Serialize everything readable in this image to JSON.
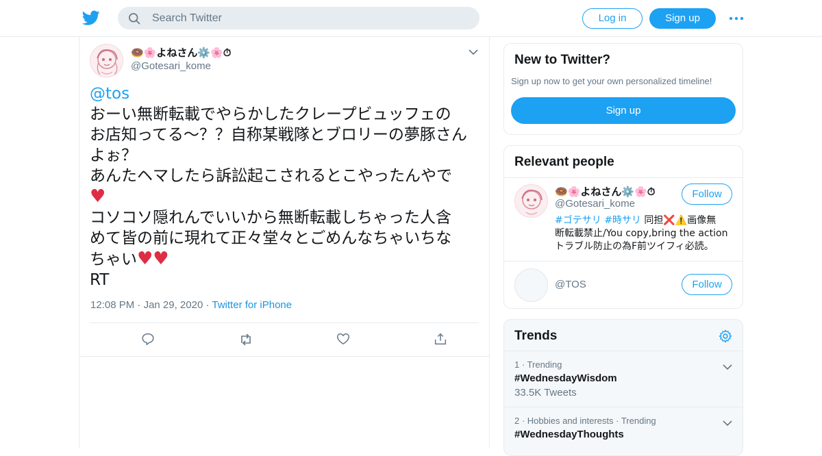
{
  "header": {
    "search_placeholder": "Search Twitter",
    "login_label": "Log in",
    "signup_label": "Sign up",
    "brand_color": "#1da1f2"
  },
  "tweet": {
    "name": "🍩🌸よねさん⚙️🌸⏱",
    "handle": "@Gotesari_kome",
    "mention": "@tos",
    "lines": [
      "おーい無断転載でやらかしたクレープビュッフェの",
      "お店知ってる〜？？自称某戦隊とブロリーの夢豚さん",
      "よぉ？",
      "あんたヘマしたら訴訟起こされるとこやったんやで",
      "コソコソ隠れんでいいから無断転載しちゃった人含",
      "めて皆の前に現れて正々堂々とごめんなちゃいちな",
      "ちゃい",
      "RT"
    ],
    "time": "12:08 PM",
    "date": "Jan 29, 2020",
    "source": "Twitter for iPhone"
  },
  "new_to_twitter": {
    "title": "New to Twitter?",
    "subtitle": "Sign up now to get your own personalized timeline!",
    "button": "Sign up"
  },
  "relevant_people": {
    "title": "Relevant people",
    "people": [
      {
        "name": "🍩🌸よねさん⚙️🌸⏱",
        "handle": "@Gotesari_kome",
        "bio_tag1": "#ゴテサリ",
        "bio_tag2": "#時サリ",
        "bio_rest1": " 同担❌⚠️画像無",
        "bio_rest2": "断転載禁止/You copy,bring the action",
        "bio_rest3": "トラブル防止の為F前ツイフィ必読。",
        "follow": "Follow"
      },
      {
        "name": "",
        "handle": "@TOS",
        "follow": "Follow"
      }
    ]
  },
  "trends": {
    "title": "Trends",
    "items": [
      {
        "meta": "1 · Trending",
        "name": "#WednesdayWisdom",
        "count": "33.5K Tweets"
      },
      {
        "meta": "2 · Hobbies and interests · Trending",
        "name": "#WednesdayThoughts",
        "count": ""
      }
    ]
  }
}
